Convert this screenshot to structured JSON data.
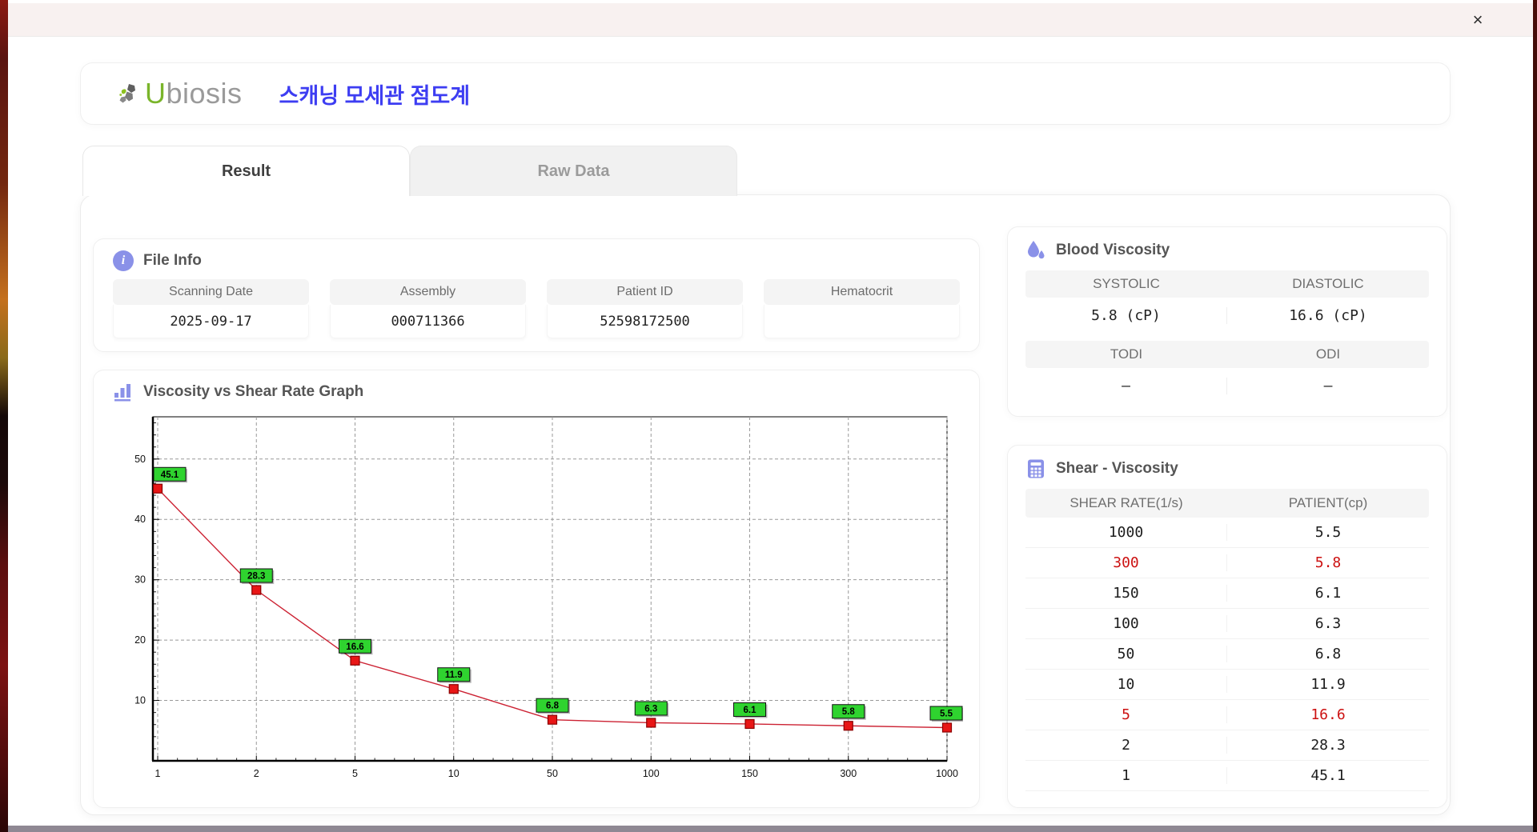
{
  "window": {
    "close_label": "×"
  },
  "header": {
    "logo_u": "U",
    "logo_rest": "biosis",
    "app_title": "스캐닝 모세관 점도계"
  },
  "tabs": [
    {
      "label": "Result",
      "active": true
    },
    {
      "label": "Raw Data",
      "active": false
    }
  ],
  "file_info": {
    "title": "File Info",
    "fields": [
      {
        "label": "Scanning Date",
        "value": "2025-09-17"
      },
      {
        "label": "Assembly",
        "value": "000711366"
      },
      {
        "label": "Patient ID",
        "value": "52598172500"
      },
      {
        "label": "Hematocrit",
        "value": ""
      }
    ]
  },
  "blood_viscosity": {
    "title": "Blood Viscosity",
    "cells": [
      {
        "label": "SYSTOLIC",
        "value": "5.8 (cP)"
      },
      {
        "label": "DIASTOLIC",
        "value": "16.6 (cP)"
      },
      {
        "label": "TODI",
        "value": "–"
      },
      {
        "label": "ODI",
        "value": "–"
      }
    ]
  },
  "shear_table": {
    "title": "Shear - Viscosity",
    "columns": [
      "SHEAR RATE(1/s)",
      "PATIENT(cp)"
    ],
    "rows": [
      {
        "shear_rate": "1000",
        "patient": "5.5",
        "highlight": false
      },
      {
        "shear_rate": "300",
        "patient": "5.8",
        "highlight": true
      },
      {
        "shear_rate": "150",
        "patient": "6.1",
        "highlight": false
      },
      {
        "shear_rate": "100",
        "patient": "6.3",
        "highlight": false
      },
      {
        "shear_rate": "50",
        "patient": "6.8",
        "highlight": false
      },
      {
        "shear_rate": "10",
        "patient": "11.9",
        "highlight": false
      },
      {
        "shear_rate": "5",
        "patient": "16.6",
        "highlight": true
      },
      {
        "shear_rate": "2",
        "patient": "28.3",
        "highlight": false
      },
      {
        "shear_rate": "1",
        "patient": "45.1",
        "highlight": false
      }
    ]
  },
  "graph": {
    "title": "Viscosity vs Shear Rate Graph"
  },
  "chart_data": {
    "type": "line",
    "title": "Viscosity vs Shear Rate Graph",
    "x_scale": "categorical (log-like shear rates, evenly spaced ticks)",
    "categories": [
      "1",
      "2",
      "5",
      "10",
      "50",
      "100",
      "150",
      "300",
      "1000"
    ],
    "series": [
      {
        "name": "PATIENT(cp)",
        "values": [
          45.1,
          28.3,
          16.6,
          11.9,
          6.8,
          6.3,
          6.1,
          5.8,
          5.5
        ]
      }
    ],
    "point_labels": [
      "45.1",
      "28.3",
      "16.6",
      "11.9",
      "6.8",
      "6.3",
      "6.1",
      "5.8",
      "5.5"
    ],
    "xlabel": "",
    "ylabel": "",
    "ylim": [
      0,
      57
    ],
    "yticks": [
      10,
      20,
      30,
      40,
      50
    ],
    "grid": "dashed",
    "legend_position": "none",
    "line_color": "#cc2233",
    "marker_color": "#e81616",
    "marker_border": "#8b0000",
    "label_bg": "#2fd32f",
    "label_border": "#111111"
  },
  "colors": {
    "accent_icon": "#8a91e8",
    "app_title_blue": "#3d3df2",
    "logo_green": "#7ab52a",
    "logo_gray": "#9a9a9a",
    "highlight_red": "#cc1111",
    "header_gray_bg": "#f5f5f5"
  }
}
